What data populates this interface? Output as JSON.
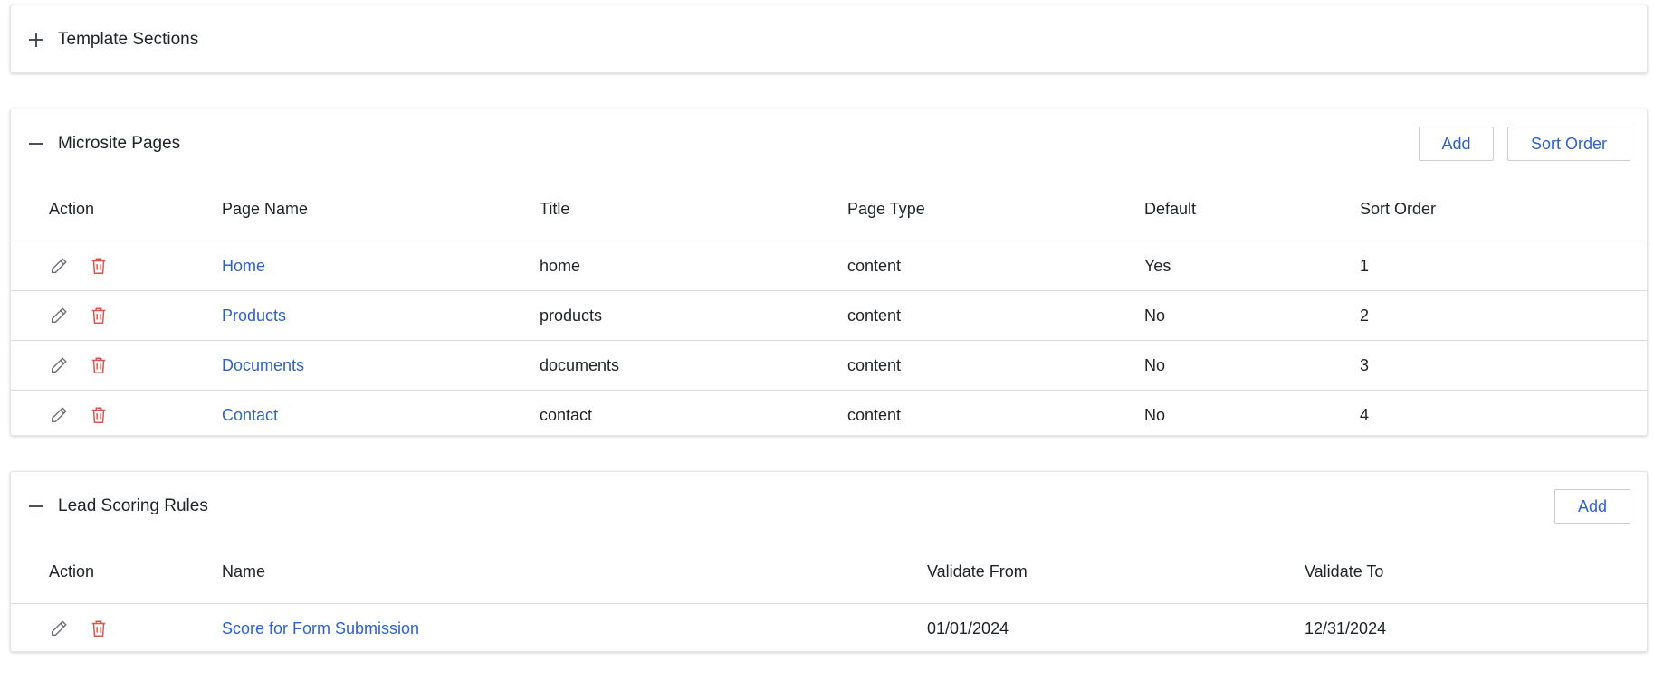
{
  "template_sections": {
    "title": "Template Sections",
    "toggle_icon": "plus-icon"
  },
  "microsite_pages": {
    "title": "Microsite Pages",
    "toggle_icon": "minus-icon",
    "add_label": "Add",
    "sort_order_label": "Sort Order",
    "columns": [
      "Action",
      "Page Name",
      "Title",
      "Page Type",
      "Default",
      "Sort Order"
    ],
    "rows": [
      {
        "page_name": "Home",
        "title": "home",
        "page_type": "content",
        "default": "Yes",
        "sort_order": "1"
      },
      {
        "page_name": "Products",
        "title": "products",
        "page_type": "content",
        "default": "No",
        "sort_order": "2"
      },
      {
        "page_name": "Documents",
        "title": "documents",
        "page_type": "content",
        "default": "No",
        "sort_order": "3"
      },
      {
        "page_name": "Contact",
        "title": "contact",
        "page_type": "content",
        "default": "No",
        "sort_order": "4"
      }
    ]
  },
  "lead_scoring_rules": {
    "title": "Lead Scoring Rules",
    "toggle_icon": "minus-icon",
    "add_label": "Add",
    "columns": [
      "Action",
      "Name",
      "Validate From",
      "Validate To"
    ],
    "rows": [
      {
        "name": "Score for Form Submission",
        "validate_from": "01/01/2024",
        "validate_to": "12/31/2024"
      }
    ]
  },
  "icons": {
    "edit": "pencil-icon",
    "delete": "trash-icon"
  },
  "colors": {
    "link": "#2f62c9",
    "delete_icon": "#d9534f",
    "edit_icon": "#6b6f75",
    "border": "#d9dce0"
  }
}
